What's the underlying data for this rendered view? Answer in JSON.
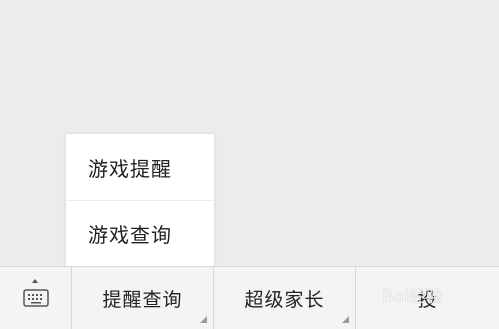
{
  "popup_menu": {
    "items": [
      {
        "label": "游戏提醒"
      },
      {
        "label": "游戏查询"
      }
    ]
  },
  "menu_bar": {
    "keyboard_icon": "keyboard-icon",
    "tabs": [
      {
        "label": "提醒查询"
      },
      {
        "label": "超级家长"
      },
      {
        "label": "投"
      }
    ]
  },
  "watermark": "Bai经验"
}
